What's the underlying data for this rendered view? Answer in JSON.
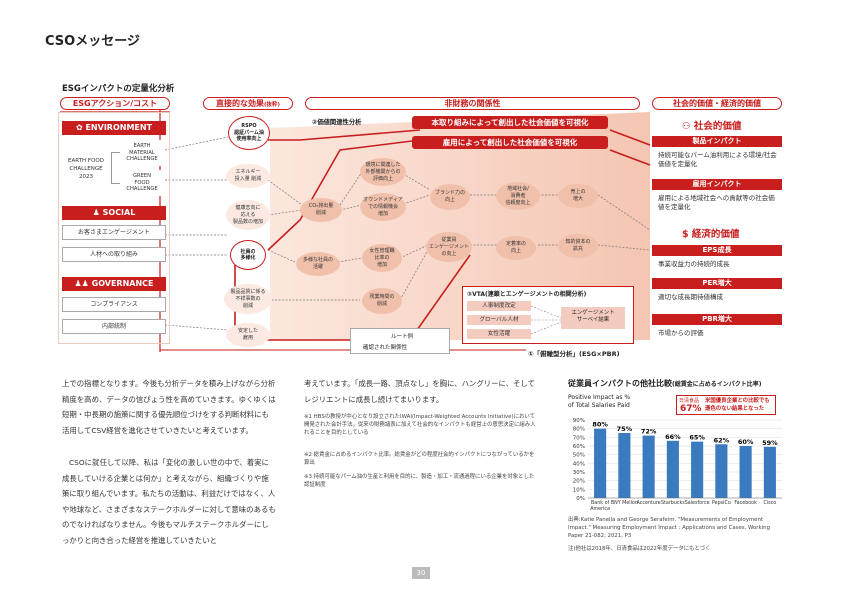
{
  "page": {
    "title": "CSOメッセージ",
    "page_number": "30"
  },
  "diagram": {
    "title": "ESGインパクトの定量化分析",
    "headers": {
      "esg_action": "ESGアクション/コスト",
      "direct_effect": "直接的な効果",
      "direct_effect_sub": "(抜粋)",
      "nonfinancial": "非財務の関係性",
      "social_value": "社会的価値・経済的価値"
    },
    "environment": {
      "title": "ENVIRONMENT",
      "left_box": "EARTH FOOD\nCHALLENGE\n2023",
      "item1": "EARTH\nMATERIAL\nCHALLENGE",
      "item2": "GREEN\nFOOD\nCHALLENGE"
    },
    "social": {
      "title": "SOCIAL",
      "item1": "お客さまエンゲージメント",
      "item2": "人材への取り組み"
    },
    "governance": {
      "title": "GOVERNANCE",
      "item1": "コンプライアンス",
      "item2": "内部統制"
    },
    "nodes": {
      "rspo": "RSPO\n認証パーム油\n使用率向上",
      "energy": "エネルギー\n投入量 削減",
      "health": "健康志向に\n応える\n製品数の増加",
      "diversity": "社員の\n多様化",
      "product_quality": "製品品質に係る\n不祥事数の\n削減",
      "stable_labor": "安定した\n雇用",
      "value_analysis": "②価値関連性分析",
      "co2": "CO₂排出量\n削減",
      "external_eval": "環境に関連した\n外部機関からの\n評価向上",
      "owned_media": "オウンドメディア\nでの情報機会\n増加",
      "diverse_talent": "多様な社員の\n活躍",
      "brand": "ブランド力の\n向上",
      "female": "女性管理職\n比率の\n増加",
      "overtime": "残業時間の\n削減",
      "engagement": "従業員\nエンゲージメント\nの向上",
      "local": "地域社会/\n消費者\n信頼度向上",
      "retention": "定着率の\n向上",
      "sales": "売上の\n増大",
      "ip": "知的資本の\n拡充"
    },
    "vta": {
      "title": "③VTA(連鎖とエンゲージメントの相関分析)",
      "items": [
        "人事制度改定",
        "グローバル人材",
        "女性活躍"
      ],
      "result": "エンゲージメント\nサーベイ結果"
    },
    "ribbons": {
      "r1": "本取り組みによって創出した社会価値を可視化",
      "r2": "雇用によって創出した社会価値を可視化"
    },
    "legend": {
      "route": "ルート例",
      "verified": "確認された関係性",
      "panel_footer": "①「俯瞰型分析」(ESG×PBR)"
    },
    "right": {
      "social_title": "社会的価値",
      "product_impact": "製品インパクト",
      "product_desc": "持続可能なパーム油利用による環境/社会価値を定量化",
      "employment_impact": "雇用インパクト",
      "employment_desc": "雇用による地域社会への貢献等の社会価値を定量化",
      "economic_title": "経済的価値",
      "eps": "EPS成長",
      "eps_desc": "事業収益力の持続的成長",
      "per": "PER増大",
      "per_desc": "適切な成長期待値構成",
      "pbr": "PBR増大",
      "pbr_desc": "市場からの評価"
    }
  },
  "body": {
    "col1": [
      "上での指標となります。今後も分析データを積み上げながら分析精度を高め、データの信ぴょう性を高めていきます。ゆくゆくは短期・中長期の施策に関する優先順位づけをする判断材料にも活用してCSV経営を進化させていきたいと考えています。",
      "CSOに就任して以降、私は「変化の激しい世の中で、着実に成長していける企業とは何か」と考えながら、組織づくりや施策に取り組んでいます。私たちの活動は、利益だけではなく、人や地球など、さまざまなステークホルダーに対して意味のあるものでなければなりません。今後もマルチステークホルダーにしっかりと向き合った経営を推進していきたいと"
    ],
    "col2": "考えています。「成長一路、頂点なし」を胸に、ハングリーに、そしてレジリエントに成長し続けてまいります。",
    "notes": [
      "※1 HBSの教授が中心となり設立されたIWAI(Impact-Weighted Accounts Initiative)において開発された会計手法。従来の財務諸表に加えて社会的なインパクトも経営上の意思決定に組み入れることを目的としている",
      "※2 総賃金に占めるインパクト比率。総賃金がどの程度社会的インパクトにつながっているかを算出",
      "※3 持続可能なパーム油の生産と利用を目的に、製造・加工・流通過程にいる企業を対象とした認証制度"
    ]
  },
  "chart_data": {
    "type": "bar",
    "title": "従業員インパクトの他社比較",
    "subtitle": "(総賃金に占めるインパクト比率)",
    "ylabel": "Positive Impact as %\nof Total Salaries Paid",
    "categories": [
      "Bank of America",
      "BNY Mellon",
      "Accenture",
      "Starbucks",
      "Salesforce",
      "PepsiCo",
      "Facebook",
      "Cisco"
    ],
    "values": [
      80,
      75,
      72,
      66,
      65,
      62,
      60,
      59
    ],
    "value_labels": [
      "80%",
      "75%",
      "72%",
      "66%",
      "65%",
      "62%",
      "60%",
      "59%"
    ],
    "ylim": [
      0,
      90
    ],
    "yticks": [
      "0%",
      "10%",
      "20%",
      "30%",
      "40%",
      "50%",
      "60%",
      "70%",
      "80%",
      "90%"
    ],
    "bar_color": "#3a7bbf",
    "callout_company": "日清食品",
    "callout_value": "67%",
    "callout_text": "米国優良企業との比較でも遜色のない結果となった",
    "source": "出典:Katie Panella and George Serafeim. \"Measurements of Employment Impact.\" Measuring Employment Impact : Applications and Cases, Working Paper 21-082, 2021, P3",
    "note": "注)他社は2018年、日清食品は2022年度データにもとづく"
  }
}
